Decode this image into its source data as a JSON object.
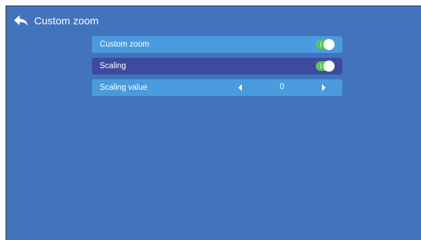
{
  "header": {
    "title": "Custom zoom",
    "back_icon": "back-arrow-icon"
  },
  "menu": {
    "items": [
      {
        "label": "Custom zoom",
        "control": "toggle",
        "state": "on"
      },
      {
        "label": "Scaling",
        "control": "toggle",
        "state": "on",
        "focused": true
      },
      {
        "label": "Scaling value",
        "control": "stepper",
        "value": "0"
      }
    ]
  },
  "colors": {
    "background": "#4174bd",
    "row": "#4a9bde",
    "row_focused": "#3c4b9d",
    "toggle_on": "#5cc25f"
  }
}
